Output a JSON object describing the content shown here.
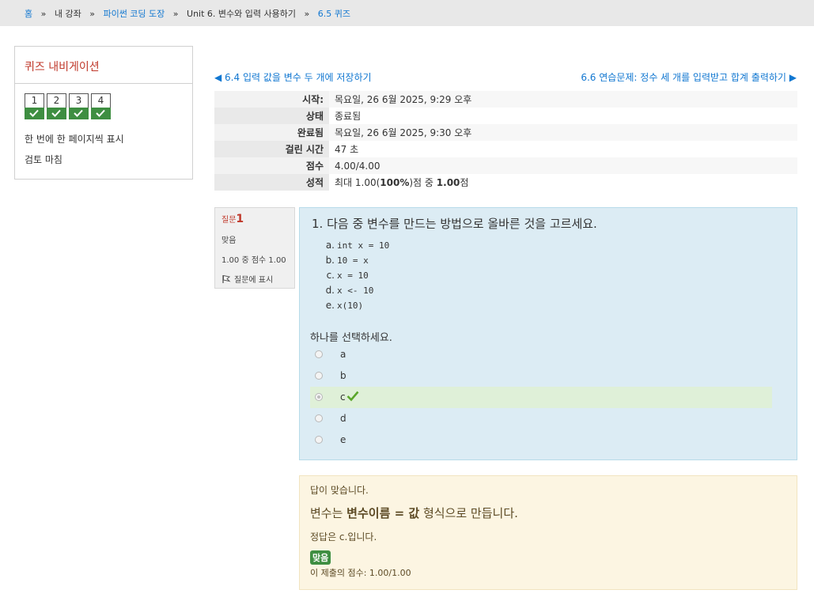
{
  "breadcrumb": {
    "items": [
      {
        "label": "홈",
        "link": true
      },
      {
        "label": "내 강좌",
        "link": false
      },
      {
        "label": "파이썬 코딩 도장",
        "link": true
      },
      {
        "label": "Unit 6. 변수와 입력 사용하기",
        "link": false
      },
      {
        "label": "6.5 퀴즈",
        "link": true
      }
    ],
    "separator": "»"
  },
  "quiz_nav": {
    "title": "퀴즈 내비게이션",
    "questions": [
      {
        "number": "1",
        "state": "correct"
      },
      {
        "number": "2",
        "state": "correct"
      },
      {
        "number": "3",
        "state": "correct"
      },
      {
        "number": "4",
        "state": "correct"
      }
    ],
    "show_one_page": "한 번에 한 페이지씩 표시",
    "finish_review": "검토 마침"
  },
  "pager": {
    "prev": "◀ 6.4 입력 값을 변수 두 개에 저장하기",
    "next": "6.6 연습문제: 정수 세 개를 입력받고 합계 출력하기 ▶"
  },
  "summary": {
    "rows": [
      {
        "label": "시작:",
        "value": "목요일, 26 6월 2025, 9:29 오후"
      },
      {
        "label": "상태",
        "value": "종료됨"
      },
      {
        "label": "완료됨",
        "value": "목요일, 26 6월 2025, 9:30 오후"
      },
      {
        "label": "걸린 시간",
        "value": "47 초"
      },
      {
        "label": "점수",
        "value": "4.00/4.00"
      }
    ],
    "grade_label": "성적",
    "grade_prefix": "최대 1.00(",
    "grade_percent": "100%",
    "grade_mid": ")점 중 ",
    "grade_value": "1.00",
    "grade_suffix": "점"
  },
  "question_info": {
    "label": "질문",
    "number": "1",
    "state": "맞음",
    "mark": "1.00 중 점수 1.00",
    "flag": "질문에 표시"
  },
  "question": {
    "text": "1. 다음 중 변수를 만드는 방법으로 올바른 것을 고르세요.",
    "options_code": [
      {
        "label": "a.",
        "code": "int x = 10"
      },
      {
        "label": "b.",
        "code": "10 = x"
      },
      {
        "label": "c.",
        "code": "x = 10"
      },
      {
        "label": "d.",
        "code": "x <- 10"
      },
      {
        "label": "e.",
        "code": "x(10)"
      }
    ],
    "prompt": "하나를 선택하세요.",
    "answers": [
      {
        "label": "a",
        "selected": false,
        "correct": false
      },
      {
        "label": "b",
        "selected": false,
        "correct": false
      },
      {
        "label": "c",
        "selected": true,
        "correct": true
      },
      {
        "label": "d",
        "selected": false,
        "correct": false
      },
      {
        "label": "e",
        "selected": false,
        "correct": false
      }
    ]
  },
  "feedback": {
    "title": "답이 맞습니다.",
    "general_prefix": "변수는 ",
    "general_bold": "변수이름 = 값",
    "general_suffix": " 형식으로 만듭니다.",
    "right_answer": "정답은 c.입니다.",
    "badge": "맞음",
    "score": "이 제출의 점수: 1.00/1.00"
  },
  "colors": {
    "accent_link": "#1177d1",
    "correct_green": "#3e8e41",
    "question_bg": "#dcecf4",
    "feedback_bg": "#fcf5e2",
    "nav_title": "#c0392b"
  }
}
